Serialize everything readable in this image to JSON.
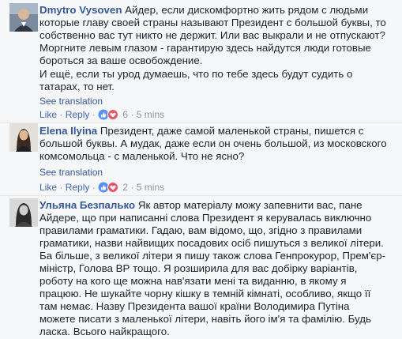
{
  "comments": [
    {
      "author": "Dmytro Vysoven",
      "text": "Айдер, если дискомфортно жить рядом с людьми которые главу своей страны называют Президент с большой буквы, то собственно вас тут никто не держит. Или вас выкрали и не отпускают? Моргните левым глазом - гарантирую здесь найдутся люди готовые бороться за ваше освобождение.",
      "text2": "И ещё, если ты урод думаешь, что по тебе здесь будут судить о татарах, то нет.",
      "see_translation": "See translation",
      "like": "Like",
      "reply": "Reply",
      "reaction_count": "6",
      "time": "5 mins"
    },
    {
      "author": "Elena Ilyina",
      "text": "Президент, даже самой маленькой страны, пишется с большой буквы. А мудак, даже если он очень большой, из московского комсомольца - с маленькой. Что не ясно?",
      "see_translation": "See translation",
      "like": "Like",
      "reply": "Reply",
      "reaction_count": "2",
      "time": "5 mins"
    },
    {
      "author": "Ульяна Безпалько",
      "text": "Як автор матеріалу можу запевнити вас, пане Айдере, що при написанні слова Президент я керувалась виключно правилами граматики. Гадаю, вам відомо, що, згідно з правилами граматики, назви найвищих посадових осіб пишуться з великої літери. Ба більше, з великої літери я пишу також слова Генпрокурор, Прем'єр-міністр, Голова ВР тощо. Я розширила для вас добірку варіантів, роботу на кого ще можна нав'язати мені та виданню, в якому я працюю. Не шукайте чорну кішку в темній кімнаті, особливо, якщо її там немає. Назву Президента вашої країни Володимира Путіна можете писати з маленької літери, навіть його ім'я та фамілію. Будь ласка. Всього найкращого."
    }
  ],
  "colors": {
    "background": "#f6f7f9",
    "author_link": "#365899",
    "action_link": "#4267b2",
    "meta_gray": "#90949c",
    "like_blue": "#5890ff",
    "love_red": "#f25268"
  },
  "icons": [
    "like-reaction-icon",
    "love-reaction-icon"
  ]
}
